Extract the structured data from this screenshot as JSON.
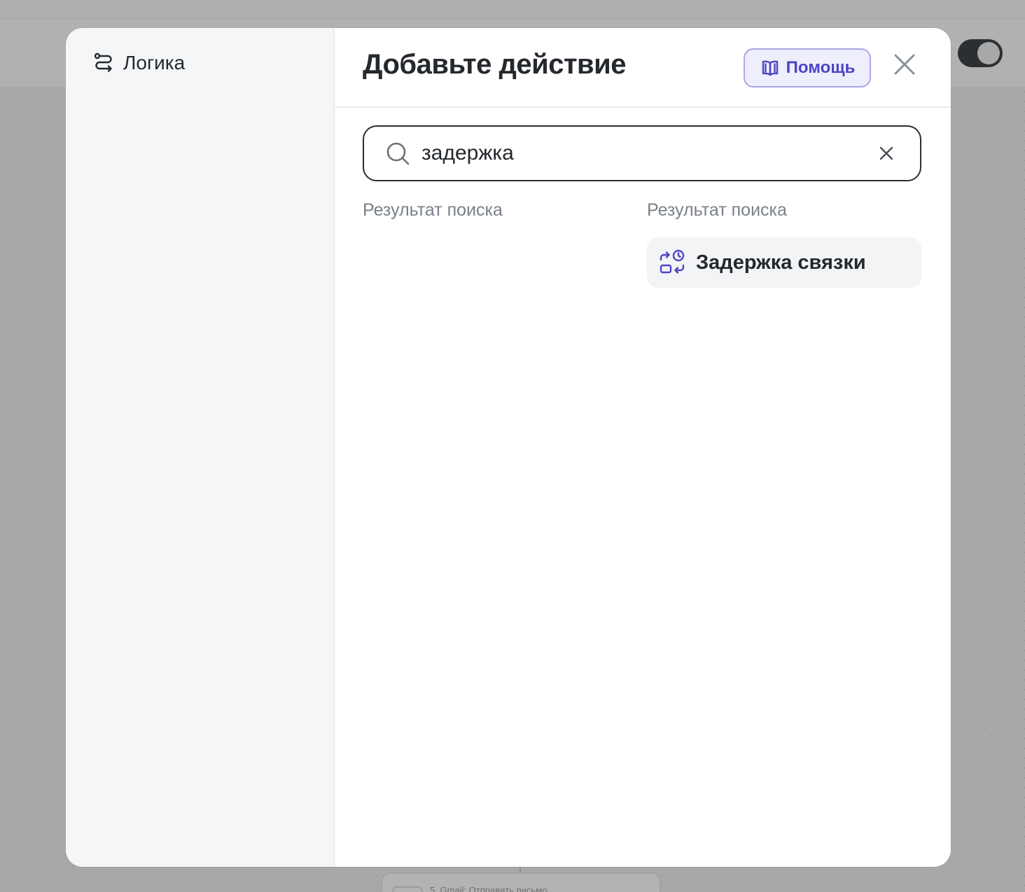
{
  "background": {
    "node_label": "5. Gmail: Отправить письмо"
  },
  "sidebar": {
    "items": [
      {
        "label": "Логика",
        "icon": "route-icon"
      }
    ]
  },
  "header": {
    "title": "Добавьте действие",
    "help_label": "Помощь",
    "help_icon": "book-icon",
    "close_icon": "close-icon"
  },
  "search": {
    "value": "задержка",
    "icon": "search-icon",
    "clear_icon": "clear-icon"
  },
  "results": {
    "left_label": "Результат поиска",
    "right_label": "Результат поиска",
    "items": [
      {
        "label": "Задержка связки",
        "icon": "delay-icon"
      }
    ]
  },
  "colors": {
    "accent": "#4b45c3",
    "accent_bg": "#eeeefc",
    "text": "#25292d",
    "muted": "#7a808a",
    "sidebar_bg": "#f4f6f8"
  }
}
